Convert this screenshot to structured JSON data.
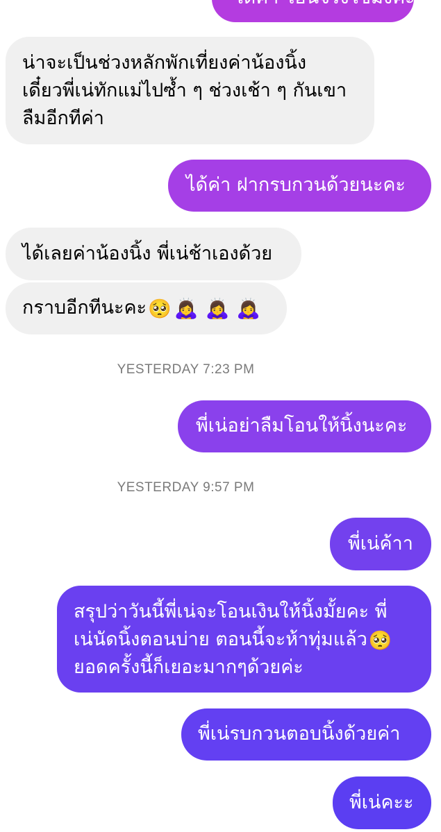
{
  "colors": {
    "incoming_bg": "#f0f0f0",
    "incoming_text": "#000000",
    "outgoing_text": "#ffffff",
    "timestamp_text": "#7a7a7a",
    "outgoing_gradient_top": "#b23be0",
    "outgoing_gradient_bottom": "#5b3ef2"
  },
  "conversation": {
    "messages": [
      {
        "id": "m0",
        "direction": "outgoing",
        "lines": [
          "ได้ค่า โอนจริงใช่มั้งคะ"
        ]
      },
      {
        "id": "m1",
        "direction": "incoming",
        "lines": [
          "น่าจะเป็นช่วงหลักพักเที่ยงค่าน้องนิ้ง",
          "เดี๋ยวพี่เน่ทักแม่ไปซ้ำ ๆ ช่วงเช้า ๆ กันเขา",
          "ลืมอีกทีค่า"
        ]
      },
      {
        "id": "m2",
        "direction": "outgoing",
        "lines": [
          "ได้ค่า ฝากรบกวนด้วยนะคะ"
        ]
      },
      {
        "id": "m3",
        "direction": "incoming",
        "lines": [
          "ได้เลยค่าน้องนิ้ง พี่เน่ช้าเองด้วย"
        ]
      },
      {
        "id": "m4",
        "direction": "incoming",
        "lines": [
          "กราบอีกทีนะคะ"
        ],
        "emoji": "pleading-face",
        "emoji_glyph": "🥺",
        "extra_emoji": [
          "🙇‍♀️",
          "🙇‍♀️",
          "🙇‍♀️"
        ]
      },
      {
        "id": "m5",
        "direction": "outgoing",
        "lines": [
          "พี่เน่อย่าลืมโอนให้นิ้งนะคะ"
        ]
      },
      {
        "id": "m6",
        "direction": "outgoing",
        "lines": [
          "พี่เน่ค้าา"
        ]
      },
      {
        "id": "m7",
        "direction": "outgoing",
        "lines": [
          "สรุปว่าวันนี้พี่เน่จะโอนเงินให้นิ้งมั้ยคะ พี่",
          "เน่นัดนิ้งตอนบ่าย ตอนนี้จะห้าทุ่มแล้ว",
          "ยอดครั้งนี้ก็เยอะมากๆด้วยค่ะ"
        ],
        "emoji_line": 1,
        "emoji": "pleading-face",
        "emoji_glyph": "🥺"
      },
      {
        "id": "m8",
        "direction": "outgoing",
        "lines": [
          "พี่เน่รบกวนตอบนิ้งด้วยค่า"
        ]
      },
      {
        "id": "m9",
        "direction": "outgoing",
        "lines": [
          "พี่เน่คะะ"
        ]
      }
    ],
    "timestamps": [
      {
        "id": "t1",
        "text": "YESTERDAY 7:23 PM"
      },
      {
        "id": "t2",
        "text": "YESTERDAY 9:57 PM"
      }
    ]
  }
}
